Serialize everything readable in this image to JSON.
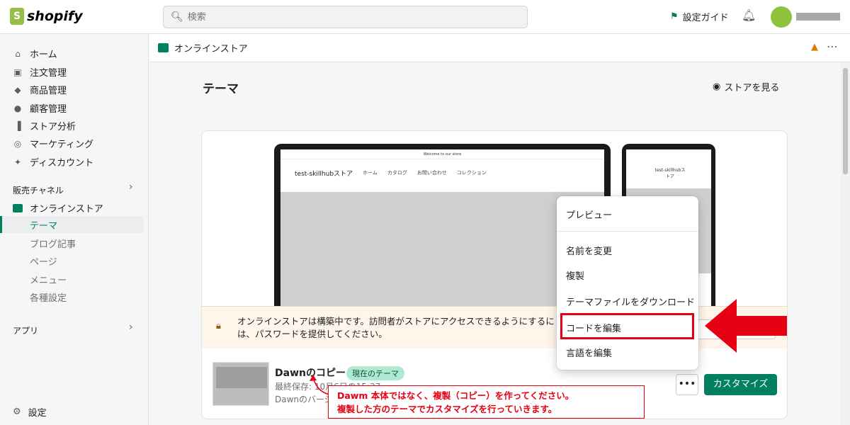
{
  "brand": {
    "name": "shopify"
  },
  "topbar": {
    "search_placeholder": "検索",
    "setup_guide": "設定ガイド"
  },
  "sidebar": {
    "items": [
      {
        "label": "ホーム",
        "icon": "home-icon"
      },
      {
        "label": "注文管理",
        "icon": "orders-icon"
      },
      {
        "label": "商品管理",
        "icon": "tag-icon"
      },
      {
        "label": "顧客管理",
        "icon": "person-icon"
      },
      {
        "label": "ストア分析",
        "icon": "analytics-icon"
      },
      {
        "label": "マーケティング",
        "icon": "target-icon"
      },
      {
        "label": "ディスカウント",
        "icon": "discount-icon"
      }
    ],
    "channels_label": "販売チャネル",
    "online_store": "オンラインストア",
    "sub_items": [
      "テーマ",
      "ブログ記事",
      "ページ",
      "メニュー",
      "各種設定"
    ],
    "apps_label": "アプリ",
    "settings_label": "設定"
  },
  "breadcrumb": {
    "label": "オンラインストア"
  },
  "page": {
    "title": "テーマ",
    "view_store": "ストアを見る"
  },
  "preview": {
    "announcement": "Welcome to our store",
    "shop_name": "test-skillhubストア",
    "nav": [
      "ホーム",
      "カタログ",
      "お問い合わせ",
      "コレクション"
    ],
    "phone_shop_name": "test-skillhubストア"
  },
  "banner": {
    "text": "オンラインストアは構築中です。訪問者がストアにアクセスできるようにするには、パスワードを提供してください。",
    "button": "フ"
  },
  "theme": {
    "name": "Dawnのコピー",
    "badge": "現在のテーマ",
    "saved": "最終保存: 10月6日の15:37",
    "version": "Dawnのバージ",
    "customize": "カスタマイズ",
    "more": "•••"
  },
  "dropdown": {
    "items": [
      "プレビュー",
      "名前を変更",
      "複製",
      "テーマファイルをダウンロード",
      "コードを編集",
      "言語を編集"
    ]
  },
  "annotation": {
    "line1": "Dawm 本体ではなく、複製（コピー）を作ってください。",
    "line2": "複製した方のテーマでカスタマイズを行っていきます。"
  },
  "colors": {
    "accent": "#008060",
    "annotation_red": "#e60012",
    "badge_bg": "#aee9d1",
    "banner_bg": "#fff5ea"
  }
}
